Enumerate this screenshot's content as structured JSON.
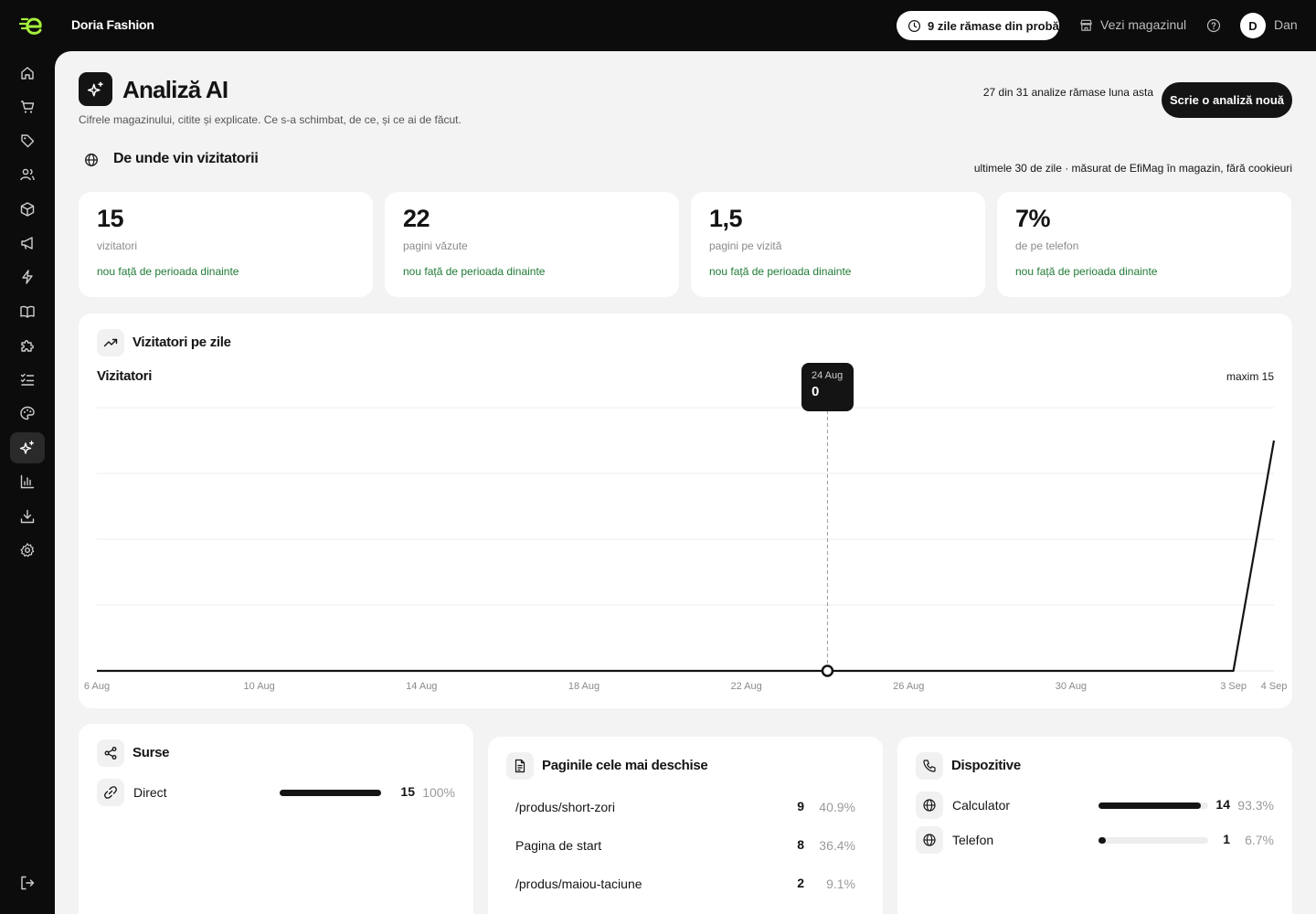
{
  "topbar": {
    "store_name": "Doria Fashion",
    "trial_label": "9 zile rămase din probă",
    "view_store_label": "Vezi magazinul",
    "avatar_initial": "D",
    "user_name": "Dan",
    "icons": [
      "efimag-logo-icon",
      "clock-icon",
      "store-icon",
      "help-icon"
    ]
  },
  "sidenav": {
    "items": [
      {
        "icon": "home-icon"
      },
      {
        "icon": "cart-icon"
      },
      {
        "icon": "tag-icon"
      },
      {
        "icon": "users-icon"
      },
      {
        "icon": "box-icon"
      },
      {
        "icon": "megaphone-icon"
      },
      {
        "icon": "lightning-icon"
      },
      {
        "icon": "book-icon"
      },
      {
        "icon": "puzzle-icon"
      },
      {
        "icon": "checklist-icon"
      },
      {
        "icon": "palette-icon"
      },
      {
        "icon": "sparkle-icon",
        "active": true
      },
      {
        "icon": "bar-chart-icon"
      },
      {
        "icon": "download-icon"
      },
      {
        "icon": "settings-icon"
      },
      {
        "icon": "logout-icon"
      }
    ]
  },
  "header": {
    "title": "Analiză AI",
    "subtitle": "Cifrele magazinului, citite și explicate. Ce s-a schimbat, de ce, și ce ai de făcut.",
    "quota_text": "27 din 31 analize rămase luna asta",
    "new_analysis_label": "Scrie o analiză nouă"
  },
  "section": {
    "title": "De unde vin vizitatorii",
    "note": "ultimele 30 de zile · măsurat de EfiMag în magazin, fără cookieuri"
  },
  "stats": [
    {
      "value": "15",
      "label": "vizitatori",
      "trend": "nou față de perioada dinainte"
    },
    {
      "value": "22",
      "label": "pagini văzute",
      "trend": "nou față de perioada dinainte"
    },
    {
      "value": "1,5",
      "label": "pagini pe vizită",
      "trend": "nou față de perioada dinainte"
    },
    {
      "value": "7%",
      "label": "de pe telefon",
      "trend": "nou față de perioada dinainte"
    }
  ],
  "visitors_chart": {
    "card_title": "Vizitatori pe zile",
    "label": "Vizitatori",
    "max_label": "maxim 15",
    "tooltip": {
      "date": "24 Aug",
      "value": "0"
    }
  },
  "chart_data": {
    "type": "line",
    "x_tick_labels": [
      "6 Aug",
      "10 Aug",
      "14 Aug",
      "18 Aug",
      "22 Aug",
      "26 Aug",
      "30 Aug",
      "3 Sep",
      "4 Sep"
    ],
    "x": [
      "6 Aug",
      "7 Aug",
      "8 Aug",
      "9 Aug",
      "10 Aug",
      "11 Aug",
      "12 Aug",
      "13 Aug",
      "14 Aug",
      "15 Aug",
      "16 Aug",
      "17 Aug",
      "18 Aug",
      "19 Aug",
      "20 Aug",
      "21 Aug",
      "22 Aug",
      "23 Aug",
      "24 Aug",
      "25 Aug",
      "26 Aug",
      "27 Aug",
      "28 Aug",
      "29 Aug",
      "30 Aug",
      "31 Aug",
      "1 Sep",
      "2 Sep",
      "3 Sep",
      "4 Sep"
    ],
    "series": [
      {
        "values": [
          0,
          0,
          0,
          0,
          0,
          0,
          0,
          0,
          0,
          0,
          0,
          0,
          0,
          0,
          0,
          0,
          0,
          0,
          0,
          0,
          0,
          0,
          0,
          0,
          0,
          0,
          0,
          0,
          0,
          14
        ]
      }
    ],
    "highlight": {
      "x": "24 Aug",
      "y": 0
    },
    "ylim": [
      0,
      16
    ],
    "grid": true
  },
  "sources": {
    "title": "Surse",
    "rows": [
      {
        "icon": "link-icon",
        "label": "Direct",
        "count": "15",
        "pct": "100%",
        "fraction": 1.0
      }
    ]
  },
  "top_pages": {
    "title": "Paginile cele mai deschise",
    "rows": [
      {
        "label": "/produs/short-zori",
        "count": "9",
        "pct": "40.9%"
      },
      {
        "label": "Pagina de start",
        "count": "8",
        "pct": "36.4%"
      },
      {
        "label": "/produs/maiou-taciune",
        "count": "2",
        "pct": "9.1%"
      }
    ]
  },
  "devices": {
    "title": "Dispozitive",
    "rows": [
      {
        "icon": "globe-icon",
        "label": "Calculator",
        "count": "14",
        "pct": "93.3%",
        "fraction": 0.933
      },
      {
        "icon": "globe-icon",
        "label": "Telefon",
        "count": "1",
        "pct": "6.7%",
        "fraction": 0.067
      }
    ]
  },
  "colors": {
    "accent": "#a6f03c",
    "dark": "#141414",
    "trend_green": "#1f7a35",
    "panel": "#f3f3f3"
  }
}
